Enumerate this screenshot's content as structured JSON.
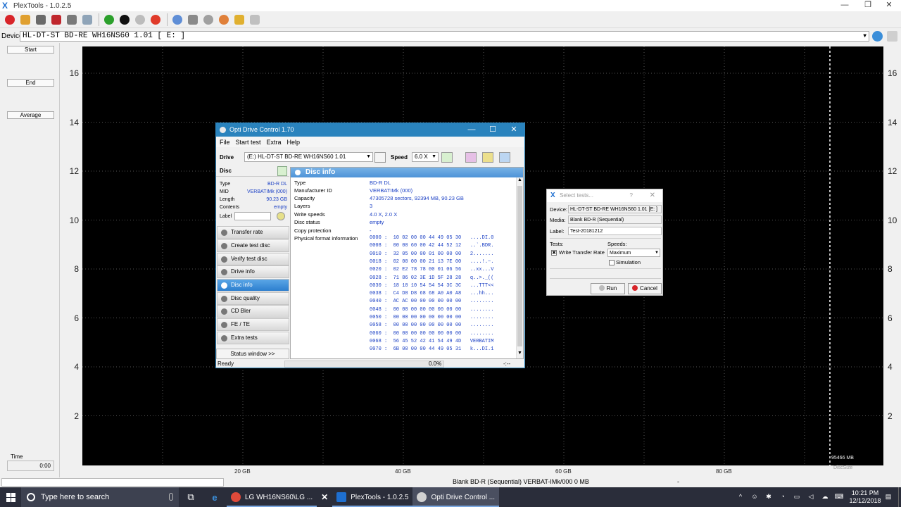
{
  "app": {
    "title": "PlexTools - 1.0.2.5",
    "min": "—",
    "max": "❐",
    "close": "✕",
    "device_label": "Device:",
    "device_value": "HL-DT-ST BD-RE  WH16NS60  1.01 [ E: ]"
  },
  "left_panel": {
    "start": "Start",
    "end": "End",
    "average": "Average",
    "time_label": "Time",
    "time_value": "0:00"
  },
  "chart": {
    "y_ticks": [
      "16",
      "14",
      "12",
      "10",
      "8",
      "6",
      "4",
      "2"
    ],
    "x_ticks": [
      "20 GB",
      "40 GB",
      "60 GB",
      "80 GB"
    ],
    "end_marker": "95466 MB",
    "x_axis_label": "DiscSize"
  },
  "statusbar": {
    "media": "Blank  BD-R (Sequential)   VERBAT-IMk/000  0 MB",
    "tail": "-"
  },
  "taskbar": {
    "search_placeholder": "Type here to search",
    "apps": [
      {
        "label": "LG WH16NS60\\LG ...",
        "color": "#e04a3a"
      },
      {
        "label": "",
        "color": "#ffffff"
      },
      {
        "label": "PlexTools - 1.0.2.5",
        "color": "#1e6fd0"
      },
      {
        "label": "Opti Drive Control ...",
        "color": "#d0d0d0"
      }
    ],
    "time": "10:21 PM",
    "date": "12/12/2018"
  },
  "odc": {
    "title": "Opti Drive Control 1.70",
    "menu": [
      "File",
      "Start test",
      "Extra",
      "Help"
    ],
    "drive_label": "Drive",
    "drive_value": "(E:)   HL-DT-ST BD-RE  WH16NS60 1.01",
    "speed_label": "Speed",
    "speed_value": "6.0 X",
    "disc_header": "Disc",
    "disc_props": [
      {
        "k": "Type",
        "v": "BD-R DL"
      },
      {
        "k": "MID",
        "v": "VERBATIMk (000)"
      },
      {
        "k": "Length",
        "v": "90.23 GB"
      },
      {
        "k": "Contents",
        "v": "empty"
      }
    ],
    "label_key": "Label",
    "nav": [
      "Transfer rate",
      "Create test disc",
      "Verify test disc",
      "Drive info",
      "Disc info",
      "Disc quality",
      "CD Bler",
      "FE / TE",
      "Extra tests"
    ],
    "nav_active": 4,
    "status_window": "Status window >>",
    "panel_title": "Disc info",
    "info": [
      {
        "k": "Type",
        "v": "BD-R DL"
      },
      {
        "k": "Manufacturer ID",
        "v": "VERBATIMk (000)"
      },
      {
        "k": "Capacity",
        "v": "47305728 sectors, 92394 MB, 90.23 GB"
      },
      {
        "k": "Layers",
        "v": "3"
      },
      {
        "k": "Write speeds",
        "v": "4.0 X, 2.0 X"
      },
      {
        "k": "Disc status",
        "v": "empty"
      },
      {
        "k": "Copy protection",
        "v": "-"
      },
      {
        "k": "Physical format information",
        "v": ""
      }
    ],
    "hex": [
      "0000 :  10 02 00 00 44 49 05 30   ....DI.0",
      "0008 :  00 00 60 00 42 44 52 12   ..`.BDR.",
      "0010 :  32 05 00 00 01 00 00 00   2.......",
      "0018 :  02 00 00 00 21 13 7E 00   ....!.~.",
      "0020 :  02 E2 78 78 00 01 06 56   ..xx...V",
      "0028 :  71 86 02 3E 1D 5F 28 28   q..>._((",
      "0030 :  18 10 10 54 54 54 3C 3C   ...TTT<<",
      "0038 :  C4 D8 D8 68 68 A0 A0 A8   ...hh...",
      "0040 :  AC AC 00 00 00 00 00 00   ........",
      "0048 :  00 00 00 00 00 00 00 00   ........",
      "0050 :  00 00 00 00 00 00 00 00   ........",
      "0058 :  00 00 00 00 00 00 00 00   ........",
      "0060 :  00 00 00 00 00 00 00 00   ........",
      "0068 :  56 45 52 42 41 54 49 4D   VERBATIM",
      "0070 :  6B 00 00 00 44 49 05 31   k...DI.1"
    ],
    "status_text": "Ready",
    "progress": "0.0%",
    "timer": "-:--"
  },
  "select_tests": {
    "title": "Select tests...",
    "help": "?",
    "close": "✕",
    "device_label": "Device:",
    "device_value": "HL-DT-ST BD-RE  WH16NS60  1.01 [E: ]",
    "media_label": "Media:",
    "media_value": "Blank BD-R (Sequential)",
    "label_label": "Label:",
    "label_value": "Test-20181212",
    "tests_label": "Tests:",
    "speeds_label": "Speeds:",
    "test_item": "Write Transfer Rate",
    "speed_value": "Maximum",
    "simulation": "Simulation",
    "run": "Run",
    "cancel": "Cancel"
  }
}
